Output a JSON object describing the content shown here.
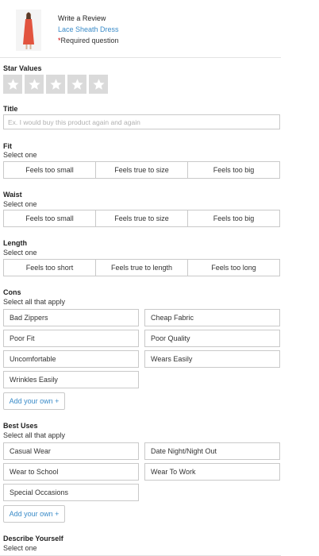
{
  "header": {
    "title": "Write a Review",
    "product": "Lace Sheath Dress",
    "required_marker": "*",
    "required_text": "Required question"
  },
  "star_values": {
    "label": "Star Values",
    "count": 5,
    "selected": 0
  },
  "title_field": {
    "label": "Title",
    "placeholder": "Ex. I would buy this product again and again",
    "value": ""
  },
  "fit": {
    "label": "Fit",
    "instruction": "Select one",
    "options": [
      "Feels too small",
      "Feels true to size",
      "Feels too big"
    ]
  },
  "waist": {
    "label": "Waist",
    "instruction": "Select one",
    "options": [
      "Feels too small",
      "Feels true to size",
      "Feels too big"
    ]
  },
  "length": {
    "label": "Length",
    "instruction": "Select one",
    "options": [
      "Feels too short",
      "Feels true to length",
      "Feels too long"
    ]
  },
  "cons": {
    "label": "Cons",
    "instruction": "Select all that apply",
    "options": [
      "Bad Zippers",
      "Cheap Fabric",
      "Poor Fit",
      "Poor Quality",
      "Uncomfortable",
      "Wears Easily",
      "Wrinkles Easily"
    ],
    "add_label": "Add your own +"
  },
  "best_uses": {
    "label": "Best Uses",
    "instruction": "Select all that apply",
    "options": [
      "Casual Wear",
      "Date Night/Night Out",
      "Wear to School",
      "Wear To Work",
      "Special Occasions"
    ],
    "add_label": "Add your own +"
  },
  "describe_yourself": {
    "label": "Describe Yourself",
    "instruction": "Select one"
  },
  "colors": {
    "link": "#3a8bc8",
    "border": "#c9c9c9",
    "star_bg": "#dadada",
    "required": "#cc0000",
    "dress": "#e2543f"
  }
}
